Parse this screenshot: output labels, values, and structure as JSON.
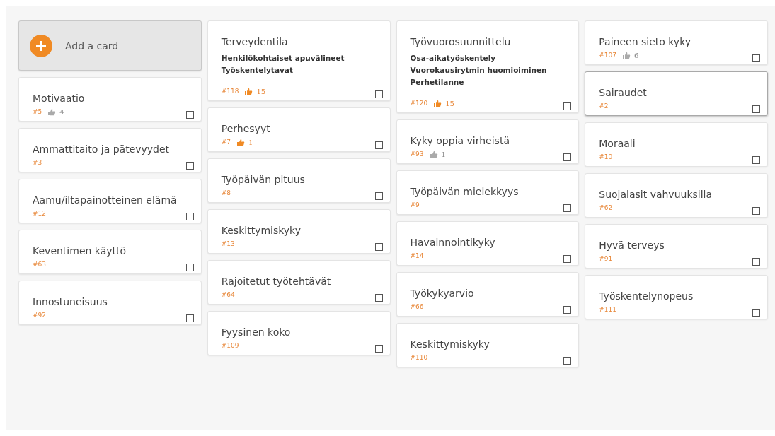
{
  "add_card": {
    "label": "Add a card"
  },
  "columns": [
    {
      "cards": [
        {
          "title": "Motivaatio",
          "number": "#5",
          "likes": "4",
          "liked": false,
          "checked": false,
          "selected": false
        },
        {
          "title": "Ammattitaito ja pätevyydet",
          "number": "#3",
          "checked": false,
          "selected": false
        },
        {
          "title": "Aamu/iltapainotteinen elämä",
          "number": "#12",
          "checked": false,
          "selected": false
        },
        {
          "title": "Keventimen käyttö",
          "number": "#63",
          "checked": false,
          "selected": false
        },
        {
          "title": "Innostuneisuus",
          "number": "#92",
          "checked": false,
          "selected": false
        }
      ]
    },
    {
      "cards": [
        {
          "title": "Terveydentila",
          "subitems": [
            "Henkilökohtaiset apuvälineet",
            "Työskentelytavat"
          ],
          "number": "#118",
          "likes": "15",
          "liked": true,
          "checked": false,
          "selected": false
        },
        {
          "title": "Perhesyyt",
          "number": "#7",
          "likes": "1",
          "liked": true,
          "checked": false,
          "selected": false
        },
        {
          "title": "Työpäivän pituus",
          "number": "#8",
          "checked": false,
          "selected": false
        },
        {
          "title": "Keskittymiskyky",
          "number": "#13",
          "checked": false,
          "selected": false
        },
        {
          "title": "Rajoitetut työtehtävät",
          "number": "#64",
          "checked": false,
          "selected": false
        },
        {
          "title": "Fyysinen koko",
          "number": "#109",
          "checked": false,
          "selected": false
        }
      ]
    },
    {
      "cards": [
        {
          "title": "Työvuorosuunnittelu",
          "subitems": [
            "Osa-aikatyöskentely",
            "Vuorokausirytmin huomioiminen",
            "Perhetilanne"
          ],
          "number": "#120",
          "likes": "15",
          "liked": true,
          "checked": false,
          "selected": false
        },
        {
          "title": "Kyky oppia virheistä",
          "number": "#93",
          "likes": "1",
          "liked": false,
          "checked": false,
          "selected": false
        },
        {
          "title": "Työpäivän mielekkyys",
          "number": "#9",
          "checked": false,
          "selected": false
        },
        {
          "title": "Havainnointikyky",
          "number": "#14",
          "checked": false,
          "selected": false
        },
        {
          "title": "Työkykyarvio",
          "number": "#66",
          "checked": false,
          "selected": false
        },
        {
          "title": "Keskittymiskyky",
          "number": "#110",
          "checked": false,
          "selected": false
        }
      ]
    },
    {
      "cards": [
        {
          "title": "Paineen sieto kyky",
          "number": "#107",
          "likes": "6",
          "liked": false,
          "checked": false,
          "selected": false
        },
        {
          "title": "Sairaudet",
          "number": "#2",
          "checked": false,
          "selected": true
        },
        {
          "title": "Moraali",
          "number": "#10",
          "checked": false,
          "selected": false
        },
        {
          "title": "Suojalasit vahvuuksilla",
          "number": "#62",
          "checked": false,
          "selected": false
        },
        {
          "title": "Hyvä terveys",
          "number": "#91",
          "checked": false,
          "selected": false
        },
        {
          "title": "Työskentelynopeus",
          "number": "#111",
          "checked": false,
          "selected": false
        }
      ]
    }
  ]
}
